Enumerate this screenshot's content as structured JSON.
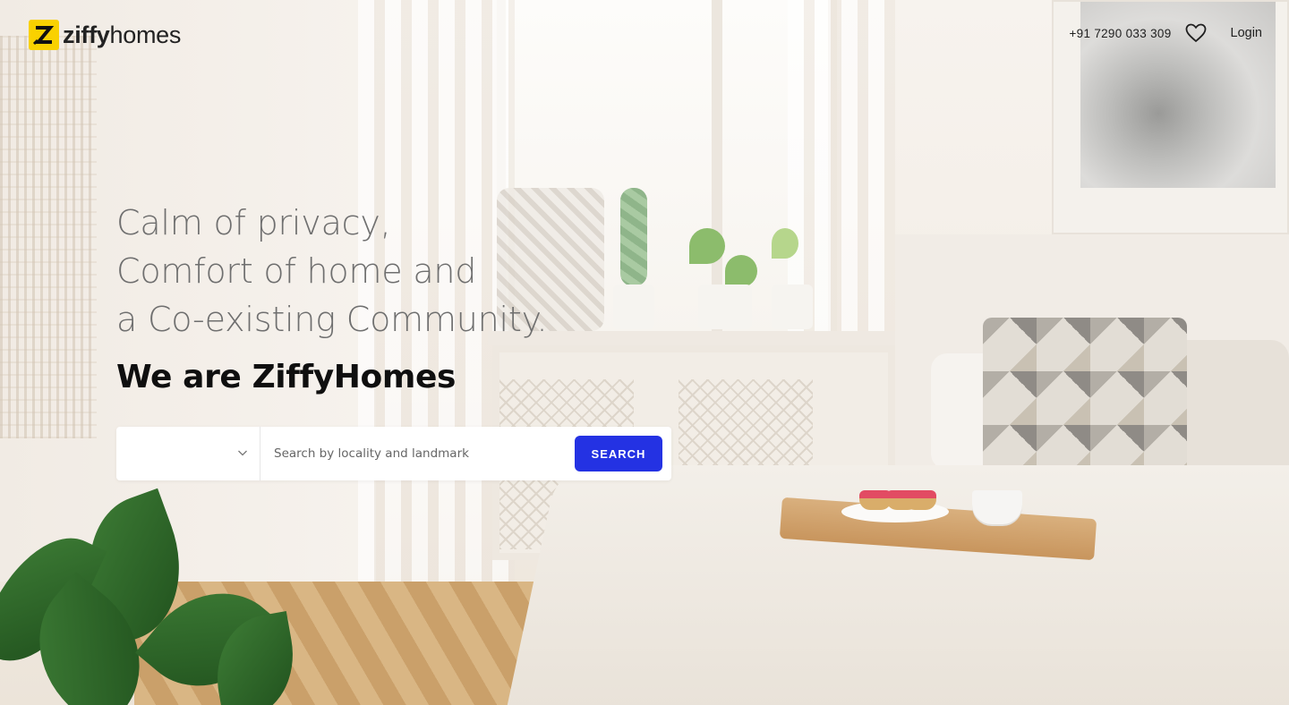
{
  "brand": {
    "logo_bold": "ziffy",
    "logo_light": "homes",
    "accent_color": "#f9d100"
  },
  "nav": {
    "phone": "+91 7290 033 309",
    "wishlist_icon": "heart-icon",
    "login_label": "Login"
  },
  "hero": {
    "tagline_lines": [
      "Calm of privacy,",
      "Comfort of home and",
      "a Co-existing Community."
    ],
    "headline": "We are ZiffyHomes"
  },
  "search": {
    "city_value": "",
    "city_icon": "chevron-down-icon",
    "placeholder": "Search by locality and landmark",
    "button_label": "SEARCH",
    "button_color": "#2432e3"
  }
}
